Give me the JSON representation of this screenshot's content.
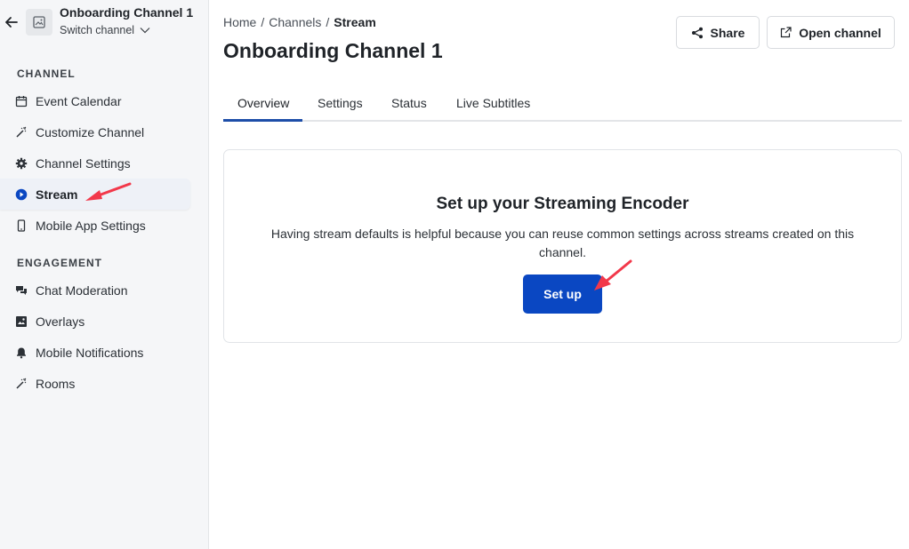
{
  "sidebar": {
    "channel_name": "Onboarding Channel 1",
    "switch_label": "Switch channel",
    "sections": [
      {
        "title": "CHANNEL"
      },
      {
        "title": "ENGAGEMENT"
      }
    ],
    "items": [
      {
        "label": "Event Calendar",
        "icon": "calendar-icon"
      },
      {
        "label": "Customize Channel",
        "icon": "magic-wand-icon"
      },
      {
        "label": "Channel Settings",
        "icon": "gear-icon"
      },
      {
        "label": "Stream",
        "icon": "play-circle-icon",
        "active": true
      },
      {
        "label": "Mobile App Settings",
        "icon": "mobile-phone-icon"
      },
      {
        "label": "Chat Moderation",
        "icon": "chat-bubbles-icon"
      },
      {
        "label": "Overlays",
        "icon": "image-gallery-icon"
      },
      {
        "label": "Mobile Notifications",
        "icon": "bell-icon"
      },
      {
        "label": "Rooms",
        "icon": "magic-wand-icon"
      }
    ]
  },
  "header": {
    "breadcrumb": [
      "Home",
      "Channels",
      "Stream"
    ],
    "breadcrumb_separator": "/",
    "title": "Onboarding Channel 1",
    "share_label": "Share",
    "open_channel_label": "Open channel"
  },
  "tabs": [
    {
      "label": "Overview",
      "active": true
    },
    {
      "label": "Settings"
    },
    {
      "label": "Status"
    },
    {
      "label": "Live Subtitles"
    }
  ],
  "card": {
    "title": "Set up your Streaming Encoder",
    "description": "Having stream defaults is helpful because you can reuse common settings across streams created on this channel.",
    "button_label": "Set up"
  },
  "colors": {
    "primary": "#0a47c2",
    "tab_underline": "#1d4ea8",
    "annotation_arrow": "#f2384a",
    "sidebar_bg": "#f5f6f8"
  }
}
